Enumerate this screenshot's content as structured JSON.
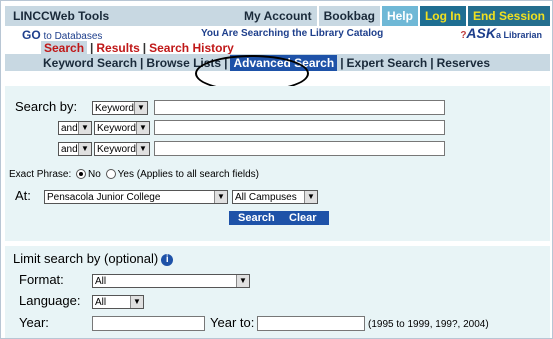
{
  "header": {
    "brand": "LINCCWeb Tools",
    "nav": [
      "My Account",
      "Bookbag",
      "Help",
      "Log In",
      "End Session"
    ]
  },
  "infobar": {
    "goto_bold": "GO",
    "goto_rest": "to Databases",
    "searching": "You Are Searching the Library Catalog",
    "ask": "ASK",
    "ask_rest": "a Librarian"
  },
  "tabs": [
    "Search",
    "Results",
    "Search History"
  ],
  "subnav": [
    "Keyword Search",
    "Browse Lists",
    "Advanced Search",
    "Expert Search",
    "Reserves"
  ],
  "form": {
    "search_by_label": "Search by:",
    "rows": [
      {
        "field": "Keyword"
      },
      {
        "bool": "and",
        "field": "Keyword"
      },
      {
        "bool": "and",
        "field": "Keyword"
      }
    ],
    "exact_phrase_label": "Exact Phrase:",
    "exact_no": "No",
    "exact_yes": "Yes",
    "exact_note": "(Applies to all search fields)",
    "exact_selected": "No",
    "at_label": "At:",
    "location": "Pensacola Junior College",
    "campus": "All Campuses",
    "search_button": "Search",
    "clear_button": "Clear"
  },
  "limits": {
    "title": "Limit search by (optional)",
    "format_label": "Format:",
    "format_value": "All",
    "language_label": "Language:",
    "language_value": "All",
    "year_label": "Year:",
    "year_to_label": "Year to:",
    "year_note": "(1995 to 1999, 199?, 2004)"
  },
  "colors": {
    "header_bg": "#c8d8e2",
    "panel_bg": "#e8f4f6",
    "accent_blue": "#1e52a8",
    "tab_red": "#c01818",
    "login_yellow": "#f0e020"
  }
}
